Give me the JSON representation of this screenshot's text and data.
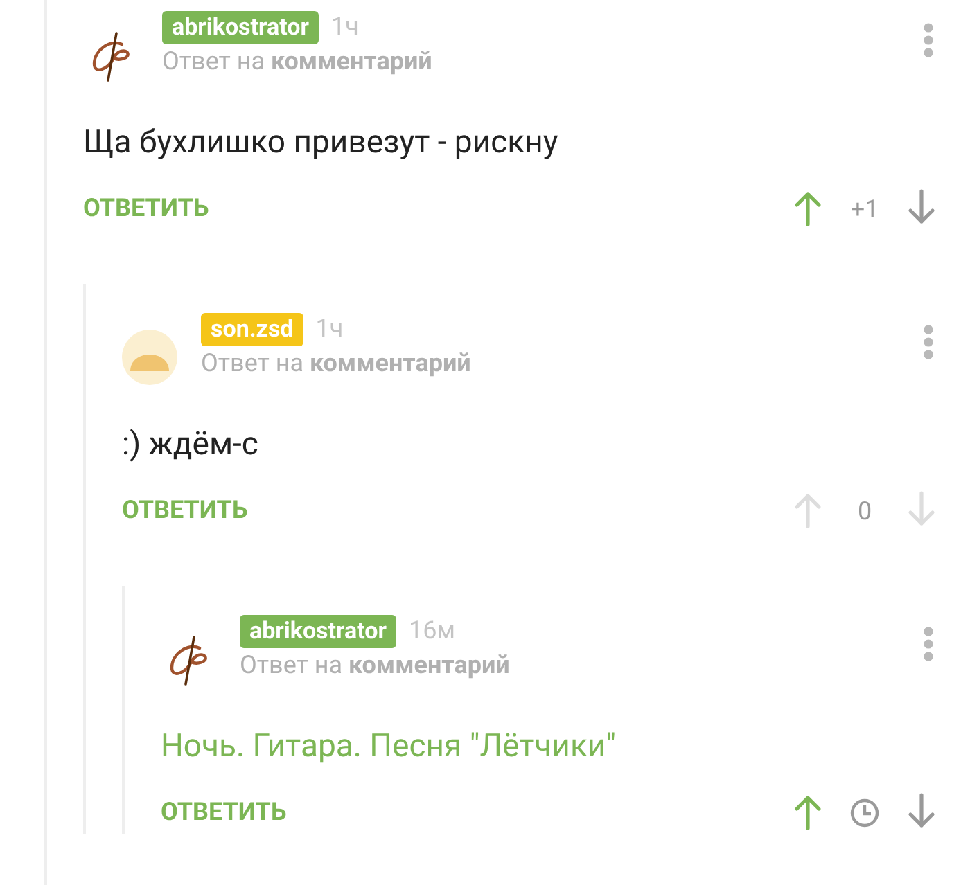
{
  "comments": [
    {
      "author": "abrikostrator",
      "color": "#7cb654",
      "avatar": {
        "kind": "sign"
      },
      "time": "1ч",
      "reply_to": "Ответ на **комментарий**",
      "body": "Ща бухлишко привезут - рискну",
      "highlighted": false,
      "reply_label": "ОТВЕТИТЬ",
      "upvoted": true,
      "voting_disabled": false,
      "score_hidden": false,
      "score": "+1",
      "children": [
        {
          "author": "son.zsd",
          "color": "#f5c518",
          "avatar": {
            "kind": "face"
          },
          "time": "1ч",
          "reply_to": "Ответ на **комментарий**",
          "body": ":) ждём-с",
          "highlighted": false,
          "reply_label": "ОТВЕТИТЬ",
          "upvoted": false,
          "voting_disabled": true,
          "score_hidden": false,
          "score": "0",
          "children": [
            {
              "author": "abrikostrator",
              "color": "#7cb654",
              "avatar": {
                "kind": "sign"
              },
              "time": "16м",
              "reply_to": "Ответ на **комментарий**",
              "body": "Ночь. Гитара. Песня \"Лётчики\"",
              "highlighted": true,
              "reply_label": "ОТВЕТИТЬ",
              "upvoted": true,
              "voting_disabled": false,
              "score_hidden": true
            }
          ]
        }
      ]
    }
  ]
}
